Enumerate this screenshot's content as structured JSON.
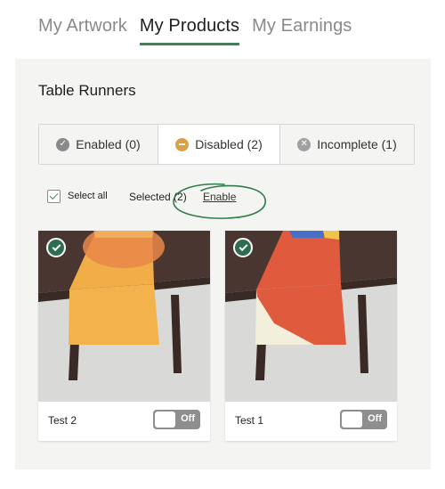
{
  "tabs": [
    {
      "label": "My Artwork",
      "active": false
    },
    {
      "label": "My Products",
      "active": true
    },
    {
      "label": "My Earnings",
      "active": false
    }
  ],
  "section_title": "Table Runners",
  "filters": [
    {
      "label": "Enabled (0)",
      "icon": "check-circle-icon"
    },
    {
      "label": "Disabled (2)",
      "icon": "minus-circle-icon",
      "selected": true
    },
    {
      "label": "Incomplete (1)",
      "icon": "x-circle-icon"
    }
  ],
  "selection": {
    "select_all_label": "Select all",
    "selected_label": "Selected (2)",
    "enable_label": "Enable"
  },
  "products": [
    {
      "name": "Test 2",
      "toggle_label": "Off",
      "checked": true
    },
    {
      "name": "Test 1",
      "toggle_label": "Off",
      "checked": true
    }
  ],
  "colors": {
    "accent": "#2e6e50",
    "tab_underline": "#4a7a5a",
    "disabled_icon": "#d8a24a",
    "toggle_off": "#8e8e8e",
    "annotation": "#2e7d4a"
  }
}
